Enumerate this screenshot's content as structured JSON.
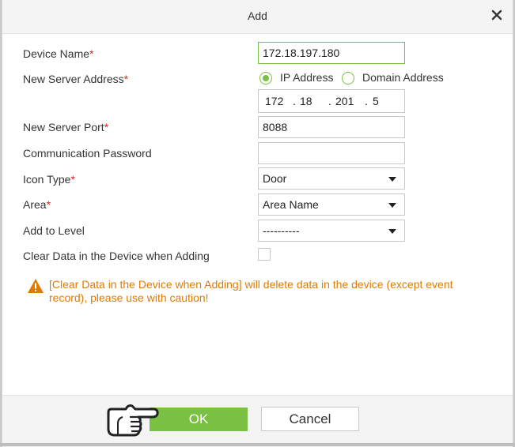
{
  "dialog": {
    "title": "Add"
  },
  "form": {
    "device_name": {
      "label": "Device Name",
      "required": "*",
      "value": "172.18.197.180"
    },
    "server_address": {
      "label": "New Server Address",
      "required": "*",
      "options": [
        "IP Address",
        "Domain Address"
      ],
      "selected": "IP Address",
      "ip": [
        "172",
        "18",
        "201",
        "5"
      ],
      "separator": "."
    },
    "server_port": {
      "label": "New Server Port",
      "required": "*",
      "value": "8088"
    },
    "comm_password": {
      "label": "Communication Password",
      "value": ""
    },
    "icon_type": {
      "label": "Icon Type",
      "required": "*",
      "value": "Door"
    },
    "area": {
      "label": "Area",
      "required": "*",
      "value": "Area Name"
    },
    "level": {
      "label": "Add to Level",
      "value": "----------"
    },
    "clear_data": {
      "label": "Clear Data in the Device when Adding",
      "checked": false
    }
  },
  "warning": {
    "text": "[Clear Data in the Device when Adding] will delete data in the device (except event record), please use with caution!"
  },
  "buttons": {
    "ok": "OK",
    "cancel": "Cancel"
  },
  "colors": {
    "accent": "#7ac143",
    "required": "#e02020",
    "warning": "#e07b00"
  },
  "icons": [
    "close-icon",
    "warning-icon",
    "pointing-hand-icon",
    "chevron-down-icon"
  ]
}
